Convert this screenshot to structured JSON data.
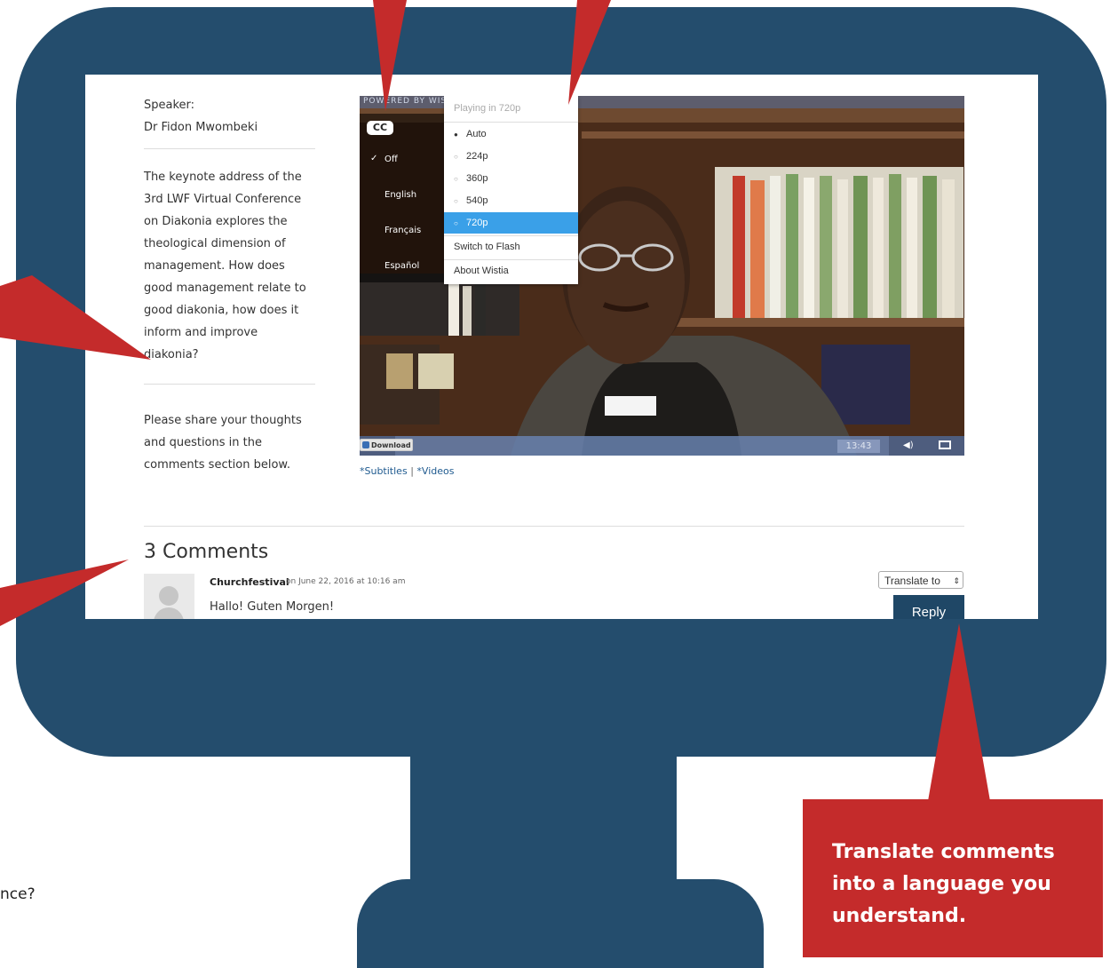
{
  "sidebar": {
    "speaker_label": "Speaker:",
    "speaker_name": "Dr Fidon Mwombeki",
    "description": "The keynote address of the 3rd LWF Virtual Conference on Diakonia explores the theological dimension of management. How does good management relate to good diakonia, how does it inform and improve diakonia?",
    "prompt": "Please share your thoughts and questions in the comments section below."
  },
  "video": {
    "powered_by": "POWERED BY WISTIA",
    "cc_label": "CC",
    "captions": [
      "Off",
      "English",
      "Français",
      "Español"
    ],
    "captions_selected": "Off",
    "quality_header": "Playing in 720p",
    "quality_options": [
      "Auto",
      "224p",
      "360p",
      "540p",
      "720p"
    ],
    "quality_selected": "720p",
    "switch_flash": "Switch to Flash",
    "about": "About Wistia",
    "duration": "13:43",
    "download_label": "Download"
  },
  "links": {
    "subtitles": "*Subtitles",
    "separator": "|",
    "videos": "*Videos"
  },
  "comments": {
    "title": "3 Comments",
    "items": [
      {
        "author": "Churchfestival",
        "date": "on June 22, 2016 at 10:16 am",
        "text": "Hallo! Guten Morgen!"
      }
    ],
    "translate_label": "Translate to",
    "reply_label": "Reply"
  },
  "callout": {
    "text": "Translate comments into a language you understand."
  },
  "edge_text": "nce?",
  "colors": {
    "monitor": "#244d6d",
    "callout": "#c42b2b",
    "reply": "#1f4766",
    "selected_quality": "#3aa0e8",
    "link": "#1f5a8f"
  }
}
